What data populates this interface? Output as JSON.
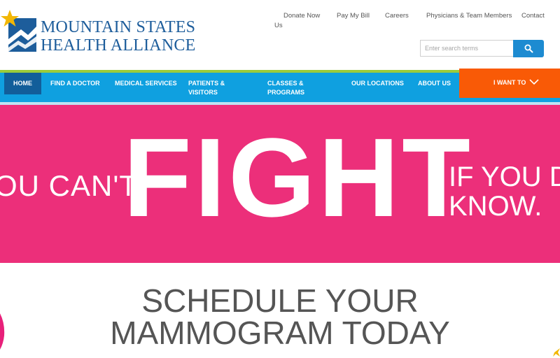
{
  "brand": {
    "line1": "MOUNTAIN STATES",
    "line2": "HEALTH ALLIANCE",
    "color": "#1d5d9b",
    "accent": "#f2b705"
  },
  "utility_nav": {
    "donate": "Donate Now",
    "bill": "Pay My Bill",
    "careers": "Careers",
    "physicians": "Physicians & Team Members",
    "contact": "Contact",
    "contact_cont": "Us"
  },
  "search": {
    "placeholder": "Enter search terms",
    "icon": "search-icon"
  },
  "nav": {
    "home": "HOME",
    "find": "FIND A DOCTOR",
    "medical": "MEDICAL SERVICES",
    "patients": "PATIENTS & VISITORS",
    "classes": "CLASSES & PROGRAMS",
    "locations": "OUR LOCATIONS",
    "about": "ABOUT US",
    "iwant": "I WANT TO",
    "colors": {
      "bar": "#0fa0e0",
      "active": "#125e9a",
      "iwant": "#f95a06",
      "stripe": "#9bcb3b"
    }
  },
  "hero": {
    "left": "OU CAN'T",
    "big": "FIGHT",
    "right1": "IF YOU D",
    "right2": "KNOW.",
    "bg": "#ec2f7a"
  },
  "cta": {
    "line1": "SCHEDULE YOUR",
    "line2": "MAMMOGRAM TODAY"
  }
}
